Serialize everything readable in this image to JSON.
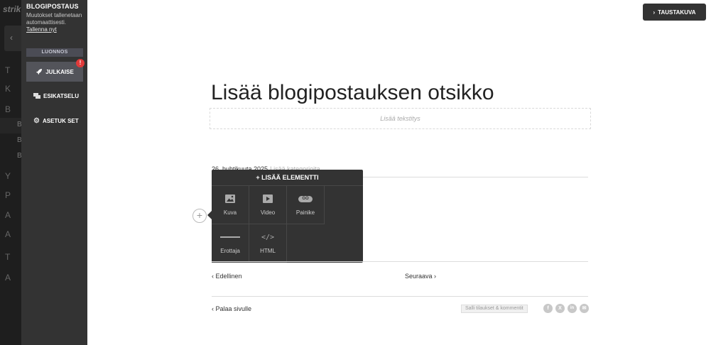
{
  "app_sidebar": {
    "logo": "strik",
    "nav_letters": [
      "T",
      "K",
      "B",
      "Y",
      "P",
      "A",
      "A",
      "T",
      "A"
    ],
    "sub_letters": [
      "B",
      "B",
      "B"
    ]
  },
  "panel": {
    "title": "BLOGIPOSTAUS",
    "note": "Muutokset tallenetaan automaattisesti.",
    "save_link": "Tallenna nyt",
    "status": "LUONNOS",
    "publish_label": "JULKAISE",
    "publish_badge": "!",
    "preview_label": "ESIKATSELU",
    "settings_label": "ASETUK SET"
  },
  "toolbar": {
    "background_button": "TAUSTAKUVA"
  },
  "post": {
    "title": "Lisää blogipostauksen otsikko",
    "subtitle_placeholder": "Lisää tekstitys",
    "date": "26. huhtikuuta 2025",
    "category_link": "Lisää kategorioita"
  },
  "add_element": {
    "header": "+ LISÄÄ ELEMENTTI",
    "items": [
      {
        "label": "Kuva",
        "icon": "image-icon"
      },
      {
        "label": "Video",
        "icon": "play-icon"
      },
      {
        "label": "Painike",
        "icon": "go-button-icon",
        "icon_text": "GO"
      },
      {
        "label": "Erottaja",
        "icon": "divider-line-icon"
      },
      {
        "label": "HTML",
        "icon": "code-icon",
        "icon_text": "</>"
      }
    ]
  },
  "navigation": {
    "previous": "Edellinen",
    "next": "Seuraava",
    "back_to_page": "Palaa sivulle",
    "allow_comments": "Salli tilaukset & kommentit"
  },
  "social_icons": [
    "f",
    "X",
    "in",
    "✉"
  ]
}
